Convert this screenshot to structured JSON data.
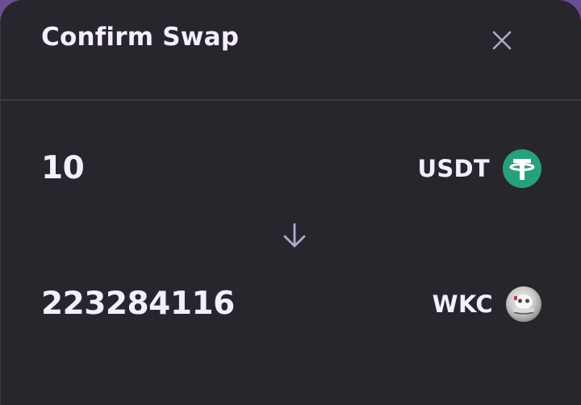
{
  "modal": {
    "title": "Confirm Swap"
  },
  "from": {
    "amount": "10",
    "symbol": "USDT"
  },
  "to": {
    "amount": "223284116",
    "symbol": "WKC"
  },
  "icons": {
    "close": "close-icon",
    "arrow": "arrow-down-icon",
    "usdt": "usdt-token-icon",
    "wkc": "wkc-token-icon"
  },
  "colors": {
    "background": "#27262d",
    "text": "#f4eefe",
    "muted": "#b2a8cf",
    "usdt": "#26a17b",
    "divider": "#3b3a42"
  }
}
